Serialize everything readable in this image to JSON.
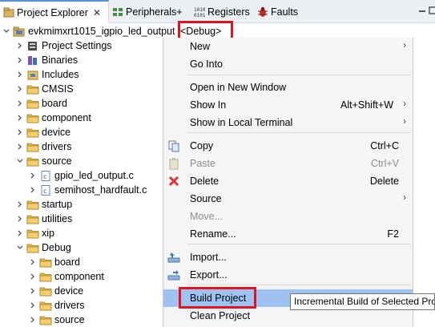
{
  "tabs": [
    {
      "label": "Project Explorer",
      "icon": "project-explorer-icon",
      "active": true
    },
    {
      "label": "Peripherals+",
      "icon": "peripherals-icon"
    },
    {
      "label": "Registers",
      "icon": "registers-icon"
    },
    {
      "label": "Faults",
      "icon": "faults-icon"
    }
  ],
  "tab_close": "✕",
  "tree": {
    "project_name": "evkmimxrt1015_igpio_led_output",
    "build_config": "<Debug>",
    "items": [
      {
        "label": "Project Settings",
        "icon": "settings-icon"
      },
      {
        "label": "Binaries",
        "icon": "binaries-icon"
      },
      {
        "label": "Includes",
        "icon": "includes-icon"
      },
      {
        "label": "CMSIS",
        "icon": "folder-icon"
      },
      {
        "label": "board",
        "icon": "folder-icon"
      },
      {
        "label": "component",
        "icon": "folder-icon"
      },
      {
        "label": "device",
        "icon": "folder-icon"
      },
      {
        "label": "drivers",
        "icon": "folder-icon"
      },
      {
        "label": "source",
        "icon": "folder-icon",
        "expanded": true
      },
      {
        "label": "gpio_led_output.c",
        "icon": "c-file-icon"
      },
      {
        "label": "semihost_hardfault.c",
        "icon": "c-file-icon"
      },
      {
        "label": "startup",
        "icon": "folder-icon"
      },
      {
        "label": "utilities",
        "icon": "folder-icon"
      },
      {
        "label": "xip",
        "icon": "folder-icon"
      },
      {
        "label": "Debug",
        "icon": "folder-icon",
        "expanded": true
      },
      {
        "label": "board",
        "icon": "folder-icon"
      },
      {
        "label": "component",
        "icon": "folder-icon"
      },
      {
        "label": "device",
        "icon": "folder-icon"
      },
      {
        "label": "drivers",
        "icon": "folder-icon"
      },
      {
        "label": "source",
        "icon": "folder-icon"
      }
    ]
  },
  "menu": {
    "items": [
      {
        "label": "New",
        "submenu": true
      },
      {
        "label": "Go Into"
      },
      {
        "label": "Open in New Window"
      },
      {
        "label": "Show In",
        "accel": "Alt+Shift+W",
        "submenu": true
      },
      {
        "label": "Show in Local Terminal",
        "submenu": true
      },
      {
        "label": "Copy",
        "accel": "Ctrl+C",
        "icon": "copy-icon"
      },
      {
        "label": "Paste",
        "accel": "Ctrl+V",
        "icon": "paste-icon",
        "disabled": true
      },
      {
        "label": "Delete",
        "accel": "Delete",
        "icon": "delete-icon"
      },
      {
        "label": "Source",
        "submenu": true
      },
      {
        "label": "Move...",
        "disabled": true
      },
      {
        "label": "Rename...",
        "accel": "F2"
      },
      {
        "label": "Import...",
        "icon": "import-icon"
      },
      {
        "label": "Export...",
        "icon": "export-icon"
      },
      {
        "label": "Build Project",
        "highlighted": true
      },
      {
        "label": "Clean Project"
      }
    ],
    "submenu_arrow": "›"
  },
  "tooltip": "Incremental Build of Selected Projects",
  "colors": {
    "highlight": "#9ec3f2",
    "annotation_red": "#e0141e",
    "folder": "#e8b84b",
    "tab_accent": "#5a8fd1"
  }
}
